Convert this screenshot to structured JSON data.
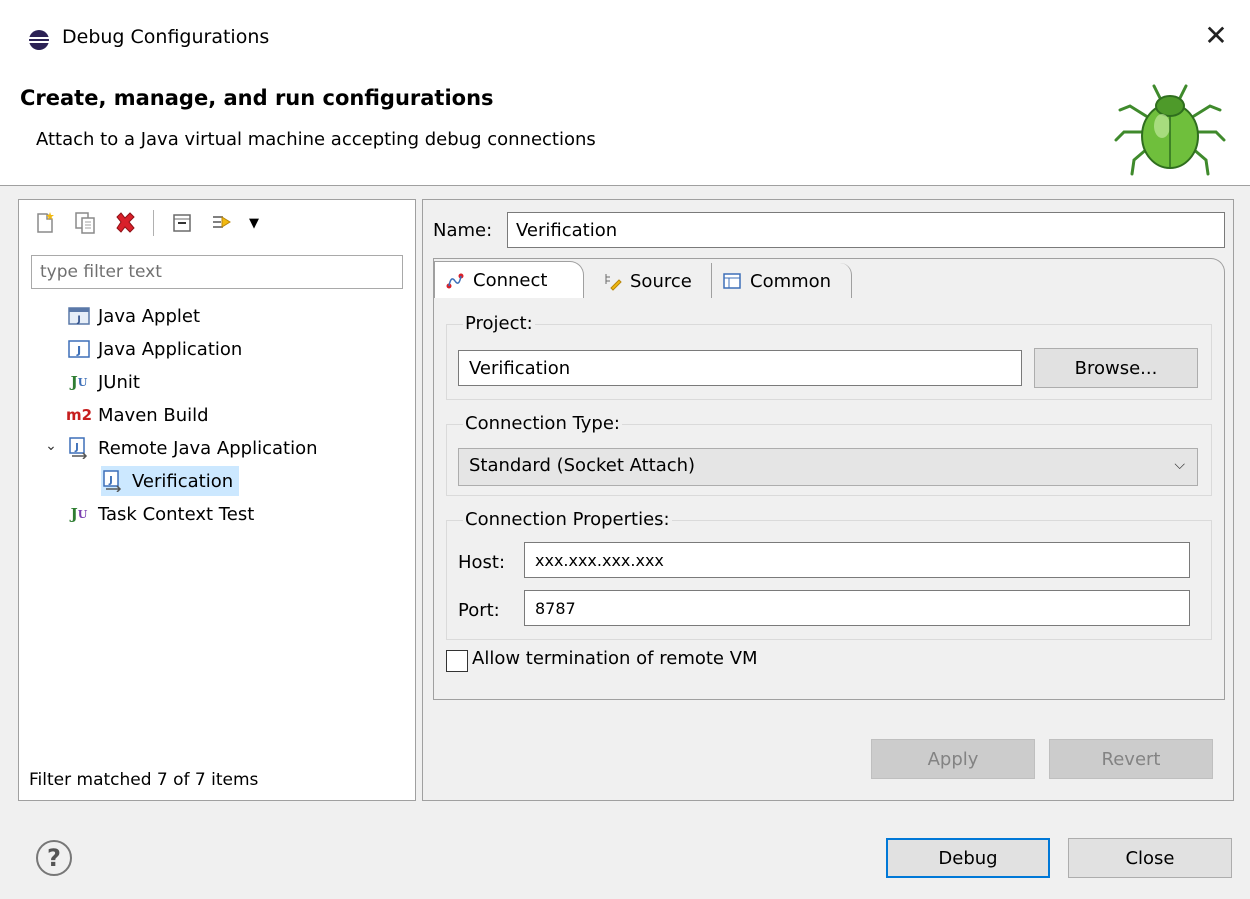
{
  "window": {
    "title": "Debug Configurations",
    "close_glyph": "✕"
  },
  "header": {
    "title": "Create, manage, and run configurations",
    "subtitle": "Attach to a Java virtual machine accepting debug connections"
  },
  "left": {
    "toolbar": [
      "new-configuration-icon",
      "duplicate-icon",
      "delete-icon",
      "collapse-all-icon",
      "filter-icon"
    ],
    "filter_placeholder": "type filter text",
    "filter_value": "",
    "tree": [
      {
        "label": "Java Applet",
        "icon": "java-applet-icon",
        "level": 0
      },
      {
        "label": "Java Application",
        "icon": "java-application-icon",
        "level": 0
      },
      {
        "label": "JUnit",
        "icon": "junit-icon",
        "level": 0
      },
      {
        "label": "Maven Build",
        "icon": "maven-icon",
        "level": 0
      },
      {
        "label": "Remote Java Application",
        "icon": "remote-java-icon",
        "level": 0,
        "expanded": true
      },
      {
        "label": "Verification",
        "icon": "remote-java-icon",
        "level": 1,
        "selected": true
      },
      {
        "label": "Task Context Test",
        "icon": "task-context-test-icon",
        "level": 0
      }
    ],
    "status": "Filter matched 7 of 7 items"
  },
  "right": {
    "name_label": "Name:",
    "name_value": "Verification",
    "tabs": [
      {
        "label": "Connect",
        "icon": "connect-icon",
        "active": true
      },
      {
        "label": "Source",
        "icon": "source-icon",
        "active": false
      },
      {
        "label": "Common",
        "icon": "common-icon",
        "active": false
      }
    ],
    "project": {
      "group_label": "Project:",
      "value": "Verification",
      "browse_label": "Browse..."
    },
    "connection_type": {
      "group_label": "Connection Type:",
      "selected": "Standard (Socket Attach)"
    },
    "connection_properties": {
      "group_label": "Connection Properties:",
      "host_label": "Host:",
      "host_value": "xxx.xxx.xxx.xxx",
      "port_label": "Port:",
      "port_value": "8787"
    },
    "allow_termination_label": "Allow termination of remote VM",
    "allow_termination_checked": false,
    "apply_label": "Apply",
    "revert_label": "Revert"
  },
  "footer": {
    "help_glyph": "?",
    "debug_label": "Debug",
    "close_label": "Close"
  },
  "colors": {
    "selection": "#cce8ff",
    "focus_border": "#0078d7",
    "delete_red": "#d9202a",
    "maven_red": "#c61e1e",
    "junit_green": "#2e7d32"
  }
}
